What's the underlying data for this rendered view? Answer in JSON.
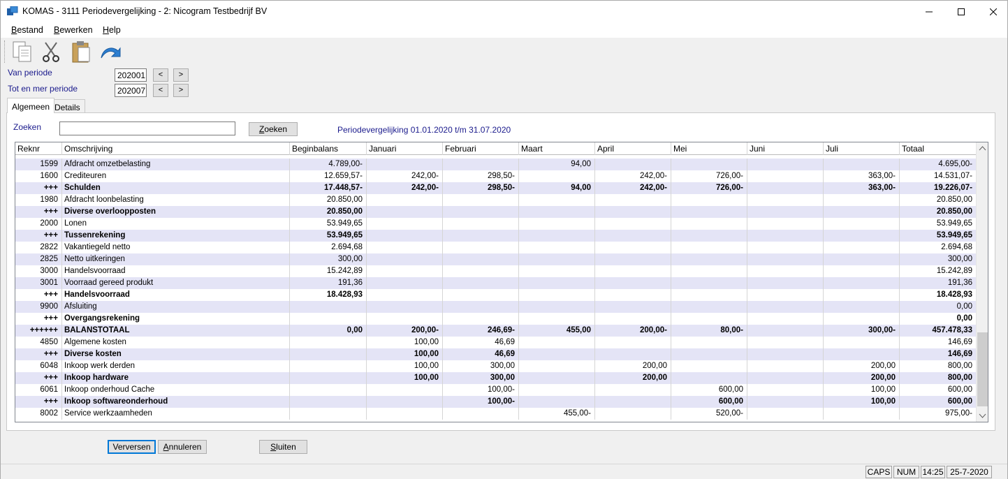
{
  "window": {
    "title": "KOMAS - 3111 Periodevergelijking - 2: Nicogram Testbedrijf BV"
  },
  "menu": {
    "items": [
      {
        "hot": "B",
        "rest": "estand"
      },
      {
        "hot": "B",
        "rest": "ewerken"
      },
      {
        "hot": "H",
        "rest": "elp"
      }
    ]
  },
  "toolbar": {
    "icons": [
      "copy-icon",
      "cut-icon",
      "paste-icon",
      "undo-icon"
    ]
  },
  "period": {
    "from_label": "Van periode",
    "from_value": "202001",
    "to_label": "Tot en mer periode",
    "to_value": "202007",
    "prev": "<",
    "next": ">"
  },
  "tabs": [
    "Algemeen",
    "Details"
  ],
  "search": {
    "label": "Zoeken",
    "value": "",
    "button_hot": "Z",
    "button_rest": "oeken",
    "info": "Periodevergelijking 01.01.2020 t/m 31.07.2020"
  },
  "table": {
    "headers": [
      "Reknr",
      "Omschrijving",
      "Beginbalans",
      "Januari",
      "Februari",
      "Maart",
      "April",
      "Mei",
      "Juni",
      "Juli",
      "Totaal"
    ],
    "rows": [
      {
        "bold": false,
        "cells": [
          "1599",
          "Afdracht omzetbelasting",
          "4.789,00-",
          "",
          "",
          "94,00",
          "",
          "",
          "",
          "",
          "4.695,00-"
        ]
      },
      {
        "bold": false,
        "cells": [
          "1600",
          "Crediteuren",
          "12.659,57-",
          "242,00-",
          "298,50-",
          "",
          "242,00-",
          "726,00-",
          "",
          "363,00-",
          "14.531,07-"
        ]
      },
      {
        "bold": true,
        "cells": [
          "+++",
          "Schulden",
          "17.448,57-",
          "242,00-",
          "298,50-",
          "94,00",
          "242,00-",
          "726,00-",
          "",
          "363,00-",
          "19.226,07-"
        ]
      },
      {
        "bold": false,
        "cells": [
          "1980",
          "Afdracht loonbelasting",
          "20.850,00",
          "",
          "",
          "",
          "",
          "",
          "",
          "",
          "20.850,00"
        ]
      },
      {
        "bold": true,
        "cells": [
          "+++",
          "Diverse overloopposten",
          "20.850,00",
          "",
          "",
          "",
          "",
          "",
          "",
          "",
          "20.850,00"
        ]
      },
      {
        "bold": false,
        "cells": [
          "2000",
          "Lonen",
          "53.949,65",
          "",
          "",
          "",
          "",
          "",
          "",
          "",
          "53.949,65"
        ]
      },
      {
        "bold": true,
        "cells": [
          "+++",
          "Tussenrekening",
          "53.949,65",
          "",
          "",
          "",
          "",
          "",
          "",
          "",
          "53.949,65"
        ]
      },
      {
        "bold": false,
        "cells": [
          "2822",
          "Vakantiegeld netto",
          "2.694,68",
          "",
          "",
          "",
          "",
          "",
          "",
          "",
          "2.694,68"
        ]
      },
      {
        "bold": false,
        "cells": [
          "2825",
          "Netto uitkeringen",
          "300,00",
          "",
          "",
          "",
          "",
          "",
          "",
          "",
          "300,00"
        ]
      },
      {
        "bold": false,
        "cells": [
          "3000",
          "Handelsvoorraad",
          "15.242,89",
          "",
          "",
          "",
          "",
          "",
          "",
          "",
          "15.242,89"
        ]
      },
      {
        "bold": false,
        "cells": [
          "3001",
          "Voorraad gereed produkt",
          "191,36",
          "",
          "",
          "",
          "",
          "",
          "",
          "",
          "191,36"
        ]
      },
      {
        "bold": true,
        "cells": [
          "+++",
          "Handelsvoorraad",
          "18.428,93",
          "",
          "",
          "",
          "",
          "",
          "",
          "",
          "18.428,93"
        ]
      },
      {
        "bold": false,
        "cells": [
          "9900",
          "Afsluiting",
          "",
          "",
          "",
          "",
          "",
          "",
          "",
          "",
          "0,00"
        ]
      },
      {
        "bold": true,
        "cells": [
          "+++",
          "Overgangsrekening",
          "",
          "",
          "",
          "",
          "",
          "",
          "",
          "",
          "0,00"
        ]
      },
      {
        "bold": true,
        "cells": [
          "++++++",
          "BALANSTOTAAL",
          "0,00",
          "200,00-",
          "246,69-",
          "455,00",
          "200,00-",
          "80,00-",
          "",
          "300,00-",
          "457.478,33"
        ]
      },
      {
        "bold": false,
        "cells": [
          "4850",
          "Algemene kosten",
          "",
          "100,00",
          "46,69",
          "",
          "",
          "",
          "",
          "",
          "146,69"
        ]
      },
      {
        "bold": true,
        "cells": [
          "+++",
          "Diverse kosten",
          "",
          "100,00",
          "46,69",
          "",
          "",
          "",
          "",
          "",
          "146,69"
        ]
      },
      {
        "bold": false,
        "cells": [
          "6048",
          "Inkoop werk derden",
          "",
          "100,00",
          "300,00",
          "",
          "200,00",
          "",
          "",
          "200,00",
          "800,00"
        ]
      },
      {
        "bold": true,
        "cells": [
          "+++",
          "Inkoop hardware",
          "",
          "100,00",
          "300,00",
          "",
          "200,00",
          "",
          "",
          "200,00",
          "800,00"
        ]
      },
      {
        "bold": false,
        "cells": [
          "6061",
          "Inkoop onderhoud Cache",
          "",
          "",
          "100,00-",
          "",
          "",
          "600,00",
          "",
          "100,00",
          "600,00"
        ]
      },
      {
        "bold": true,
        "cells": [
          "+++",
          "Inkoop softwareonderhoud",
          "",
          "",
          "100,00-",
          "",
          "",
          "600,00",
          "",
          "100,00",
          "600,00"
        ]
      },
      {
        "bold": false,
        "cells": [
          "8002",
          "Service werkzaamheden",
          "",
          "",
          "",
          "455,00-",
          "",
          "520,00-",
          "",
          "",
          "975,00-"
        ]
      }
    ]
  },
  "buttons": {
    "verversen": "Verversen",
    "annuleren_hot": "A",
    "annuleren_rest": "nnuleren",
    "sluiten_hot": "S",
    "sluiten_rest": "luiten"
  },
  "status": {
    "caps": "CAPS",
    "num": "NUM",
    "time": "14:25",
    "date": "25-7-2020"
  }
}
